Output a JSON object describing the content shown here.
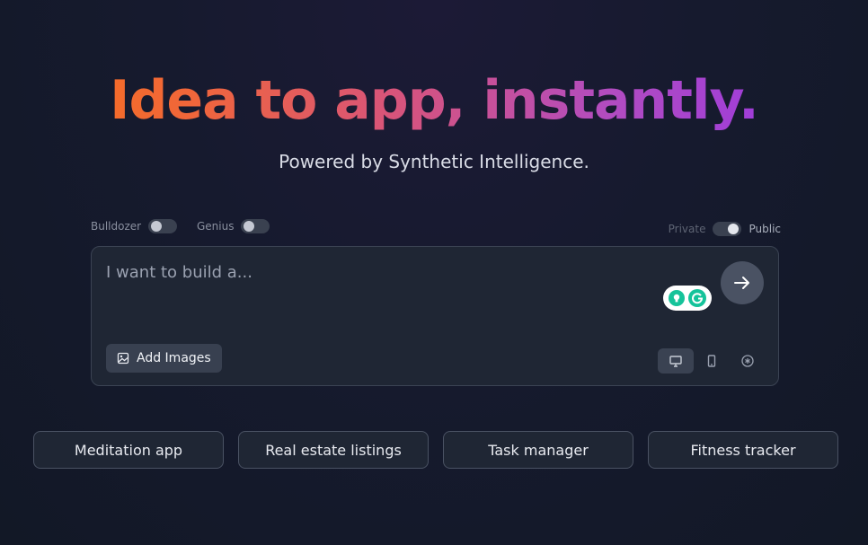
{
  "hero": {
    "title": "Idea to app, instantly.",
    "subtitle": "Powered by Synthetic Intelligence."
  },
  "modes": {
    "bulldozer": {
      "label": "Bulldozer",
      "on": false
    },
    "genius": {
      "label": "Genius",
      "on": false
    }
  },
  "visibility": {
    "private_label": "Private",
    "public_label": "Public",
    "selected": "Public"
  },
  "prompt": {
    "placeholder": "I want to build a...",
    "add_images_label": "Add Images",
    "send_icon": "arrow-right-icon",
    "device_options": [
      {
        "icon": "desktop-icon",
        "active": true
      },
      {
        "icon": "mobile-icon",
        "active": false
      },
      {
        "icon": "asterisk-circle-icon",
        "active": false
      }
    ]
  },
  "suggestions": [
    "Meditation app",
    "Real estate listings",
    "Task manager",
    "Fitness tracker"
  ],
  "colors": {
    "gradient_start": "#f97316",
    "gradient_end": "#9333ea",
    "grammarly_green": "#15c39a"
  }
}
